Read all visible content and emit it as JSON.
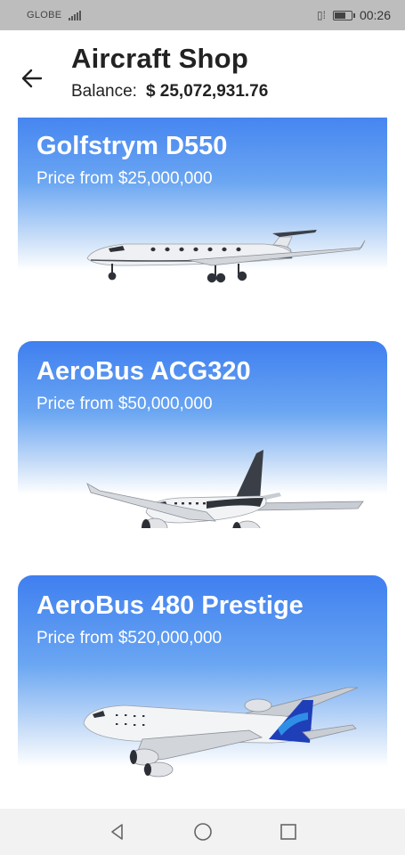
{
  "status_bar": {
    "carrier": "GLOBE",
    "time": "00:26",
    "battery_level": 0.6
  },
  "header": {
    "back_icon": "arrow-left-icon",
    "title": "Aircraft Shop",
    "balance_label": "Balance:",
    "balance_value": "$ 25,072,931.76"
  },
  "aircraft": [
    {
      "name": "Golfstrym D550",
      "price": "Price from $25,000,000",
      "icon": "business-jet-image"
    },
    {
      "name": "AeroBus ACG320",
      "price": "Price from $50,000,000",
      "icon": "narrowbody-jet-image"
    },
    {
      "name": "AeroBus 480 Prestige",
      "price": "Price from $520,000,000",
      "icon": "widebody-jet-image"
    }
  ],
  "nav": {
    "back_icon": "triangle-back-icon",
    "home_icon": "circle-home-icon",
    "recents_icon": "square-recents-icon"
  },
  "colors": {
    "card_top": "#3f7ff0",
    "card_bottom": "#ffffff",
    "status_bar": "#bdbdbd",
    "tail_accent": "#1f3fb8"
  }
}
